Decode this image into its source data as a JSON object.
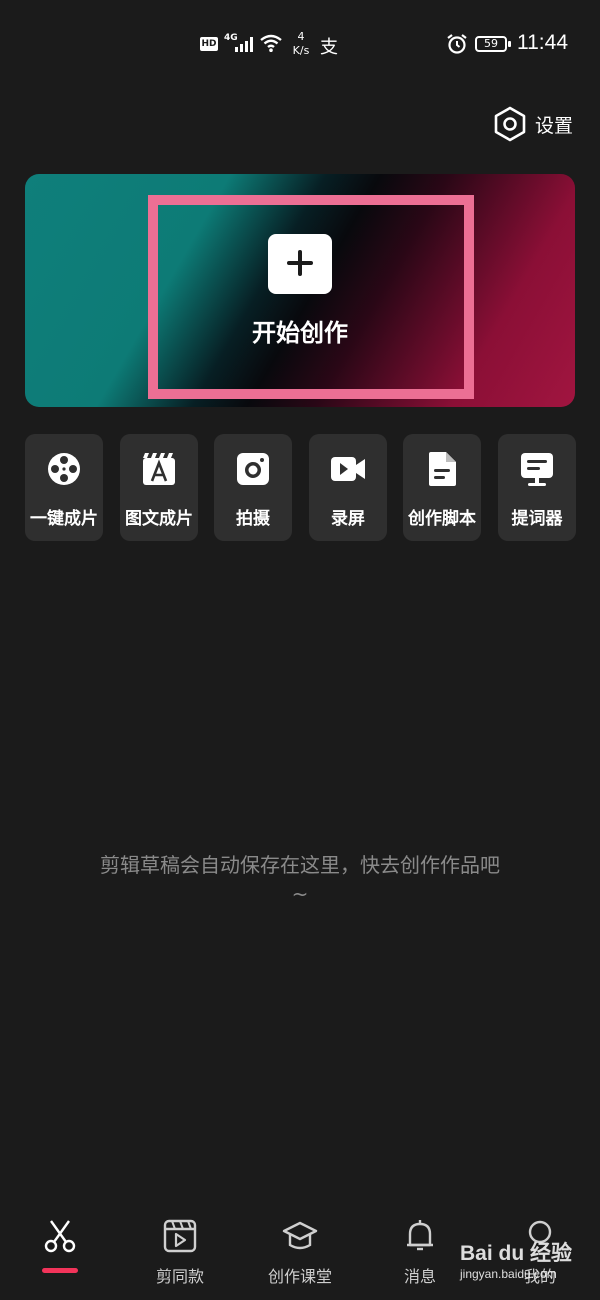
{
  "status_bar": {
    "hd": "HD",
    "network": "4G",
    "speed_value": "4",
    "speed_unit": "K/s",
    "alipay": "支",
    "battery": "59",
    "time": "11:44"
  },
  "settings": {
    "label": "设置"
  },
  "banner": {
    "label": "开始创作"
  },
  "tools": [
    {
      "label": "一键成片",
      "icon": "film-reel-icon"
    },
    {
      "label": "图文成片",
      "icon": "clapper-text-icon"
    },
    {
      "label": "拍摄",
      "icon": "camera-icon"
    },
    {
      "label": "录屏",
      "icon": "video-record-icon"
    },
    {
      "label": "创作脚本",
      "icon": "script-document-icon"
    },
    {
      "label": "提词器",
      "icon": "teleprompter-icon"
    }
  ],
  "empty_message": "剪辑草稿会自动保存在这里，快去创作作品吧~",
  "nav": [
    {
      "label": "",
      "icon": "scissors-icon",
      "active": true
    },
    {
      "label": "剪同款",
      "icon": "template-play-icon"
    },
    {
      "label": "创作课堂",
      "icon": "graduation-cap-icon"
    },
    {
      "label": "消息",
      "icon": "bell-icon"
    },
    {
      "label": "我的",
      "icon": "profile-icon"
    }
  ],
  "watermark": {
    "main": "Bai du 经验",
    "sub": "jingyan.baidu.com"
  },
  "colors": {
    "accent": "#f2345a",
    "highlight_frame": "#ec6f94",
    "background": "#1b1b1b",
    "tile": "#2f2f2f"
  }
}
